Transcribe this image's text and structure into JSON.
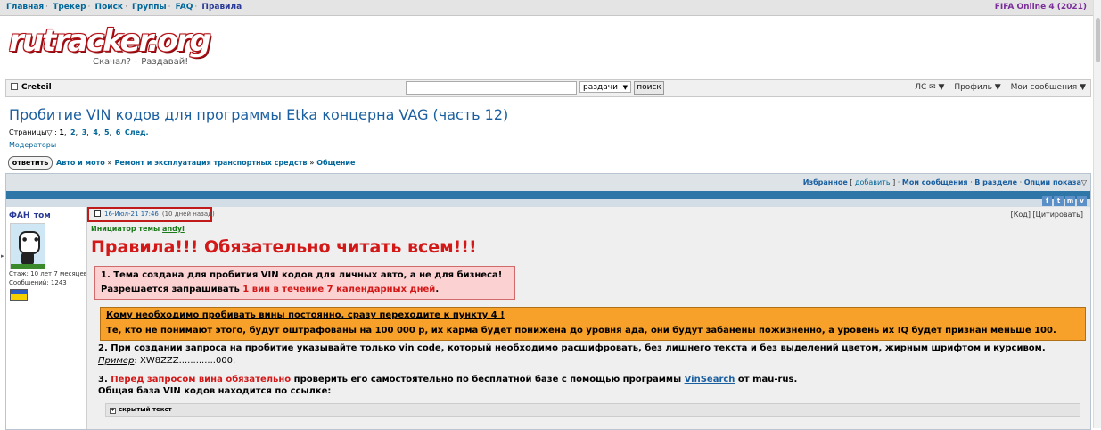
{
  "topnav": {
    "links": [
      "Главная",
      "Трекер",
      "Поиск",
      "Группы",
      "FAQ"
    ],
    "active_link": "Правила",
    "right_text": "FIFA Online 4 (2021)"
  },
  "logo": {
    "wordmark": "rutracker.org",
    "tagline": "Скачал? – Раздавай!"
  },
  "toolbar": {
    "username": "Creteil",
    "search_select": "раздачи",
    "search_button": "поиск",
    "pm": "ЛС ✉ ▼",
    "profile": "Профиль ▼",
    "my_messages": "Мои сообщения ▼"
  },
  "topic": {
    "title": "Пробитие VIN кодов для программы Etka концерна VAG (часть 12)",
    "pages_label": "Страницы",
    "pages_current": "1",
    "pages": [
      "2",
      "3",
      "4",
      "5",
      "6"
    ],
    "next": "След.",
    "moderators": "Модераторы",
    "reply": "ответить",
    "breadcrumbs": [
      "Авто и мото",
      "Ремонт и эксплуатация транспортных средств",
      "Общение"
    ]
  },
  "options_bar": {
    "favorites": "Избранное",
    "add": "добавить",
    "my_messages": "Мои сообщения",
    "in_section": "В разделе",
    "display_options": "Опции показа"
  },
  "social": [
    "f",
    "t",
    "m",
    "v"
  ],
  "post": {
    "author": "ФАН_том",
    "experience": "Стаж: 10 лет 7 месяцев",
    "messages": "Сообщений: 1243",
    "date": "16-Июл-21 17:46",
    "ago": "(10 дней назад)",
    "code_link": "[Код]",
    "quote_link": "[Цитировать]",
    "initiator_label": "Инициатор темы",
    "initiator_name": "andyl",
    "rules_heading": "Правила!!! Обязательно читать всем!!!",
    "rule1_line1": "1. Тема создана для пробития VIN кодов для личных авто, а не для бизнеса!",
    "rule1_line2_a": "Разрешается запрашивать ",
    "rule1_line2_red": "1 вин в течение 7 календарных дней",
    "rule1_line2_b": ".",
    "orange_line1": "Кому необходимо пробивать вины постоянно, сразу переходите к пункту 4 !",
    "orange_line2": "Те, кто не понимают этого, будут оштрафованы на 100 000 р, их карма будет понижена до уровня ада, они будут забанены пожизненно, а уровень их IQ будет признан меньше 100.",
    "rule2": "2. При создании запроса на пробитие указывайте только vin code, который необходимо расшифровать, без лишнего текста и без выделений цветом, жирным шрифтом и курсивом.",
    "example_label": "Пример",
    "example_value": ": XW8ZZZ.............000.",
    "rule3_num": "3. ",
    "rule3_red": "Перед запросом вина обязательно",
    "rule3_text": " проверить его самостоятельно по бесплатной базе с помощью программы ",
    "rule3_link": "VinSearch",
    "rule3_end": " от mau-rus.",
    "rule3_line2": "Общая база VIN кодов находится по ссылке:",
    "spoiler": "скрытый текст"
  },
  "colors": {
    "link": "#006699",
    "title": "#1a5fa0",
    "rules_red": "#d31818",
    "orange": "#f7a12a",
    "pink": "#fcd1d1",
    "highlight_border": "#c11a1a"
  }
}
